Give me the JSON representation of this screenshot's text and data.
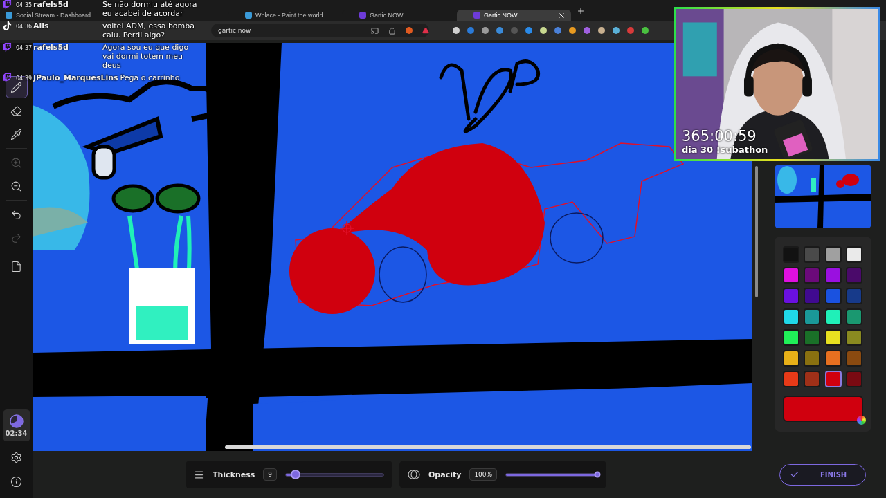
{
  "browser": {
    "tabs": [
      {
        "title": "Social Stream - Dashboard",
        "selected": false
      },
      {
        "title": "Wplace - Paint the world",
        "selected": false
      },
      {
        "title": "Gartic NOW",
        "selected": false
      },
      {
        "title": "Gartic NOW",
        "selected": true
      }
    ],
    "address": "gartic.now"
  },
  "chat": [
    {
      "kind": "twitch",
      "time": "04:35",
      "user": "rafels5d",
      "message": "Se não dormiu até agora eu acabei de acordar"
    },
    {
      "kind": "tiktok",
      "time": "04:36",
      "user": "Alis",
      "message": "voltei ADM, essa bomba caiu. Perdi algo?"
    },
    {
      "kind": "twitch",
      "time": "04:37",
      "user": "rafels5d",
      "message": "Agora sou eu que digo vai dormi totem meu deus"
    },
    {
      "kind": "twitch",
      "time": "04:39",
      "user": "JPaulo_MarquesLins",
      "message": "Pega o carrinho"
    }
  ],
  "tools": [
    {
      "kind": "pencil",
      "selected": true,
      "disabled": false
    },
    {
      "kind": "eraser",
      "selected": false,
      "disabled": false
    },
    {
      "kind": "pipette",
      "selected": false,
      "disabled": false
    },
    {
      "kind": "zoom-in",
      "selected": false,
      "disabled": true
    },
    {
      "kind": "zoom-out",
      "selected": false,
      "disabled": false
    },
    {
      "kind": "undo",
      "selected": false,
      "disabled": false
    },
    {
      "kind": "redo",
      "selected": false,
      "disabled": true
    },
    {
      "kind": "new-page",
      "selected": false,
      "disabled": false
    }
  ],
  "timer": "02:34",
  "webcam": {
    "kind": "picture",
    "countdown": "365:00:59",
    "caption": "dia 30 !subathon"
  },
  "palette": [
    {
      "color": "#121212",
      "selected": false
    },
    {
      "color": "#4a4a4a",
      "selected": false
    },
    {
      "color": "#a0a0a0",
      "selected": false
    },
    {
      "color": "#eaeaea",
      "selected": false
    },
    {
      "color": "#e010e0",
      "selected": false
    },
    {
      "color": "#6b0a7a",
      "selected": false
    },
    {
      "color": "#9a10e0",
      "selected": false
    },
    {
      "color": "#4a0a6a",
      "selected": false
    },
    {
      "color": "#6a10e0",
      "selected": false
    },
    {
      "color": "#400a90",
      "selected": false
    },
    {
      "color": "#1a52e0",
      "selected": false
    },
    {
      "color": "#173a8a",
      "selected": false
    },
    {
      "color": "#20d8e8",
      "selected": false
    },
    {
      "color": "#1a9898",
      "selected": false
    },
    {
      "color": "#20f0b8",
      "selected": false
    },
    {
      "color": "#1a9870",
      "selected": false
    },
    {
      "color": "#20f058",
      "selected": false
    },
    {
      "color": "#1a7028",
      "selected": false
    },
    {
      "color": "#e8e020",
      "selected": false
    },
    {
      "color": "#8a8a20",
      "selected": false
    },
    {
      "color": "#e8b018",
      "selected": false
    },
    {
      "color": "#8a7010",
      "selected": false
    },
    {
      "color": "#e87020",
      "selected": false
    },
    {
      "color": "#8a4a10",
      "selected": false
    },
    {
      "color": "#e83a18",
      "selected": false
    },
    {
      "color": "#a03018",
      "selected": false
    },
    {
      "color": "#d0000e",
      "selected": true
    },
    {
      "color": "#7a0a12",
      "selected": false
    }
  ],
  "current_color": {
    "color": "#d0000e"
  },
  "thickness": {
    "label": "Thickness",
    "value": "9",
    "level": 0.1
  },
  "opacity": {
    "label": "Opacity",
    "value": "100%",
    "level": 1
  },
  "finish": "FINISH"
}
